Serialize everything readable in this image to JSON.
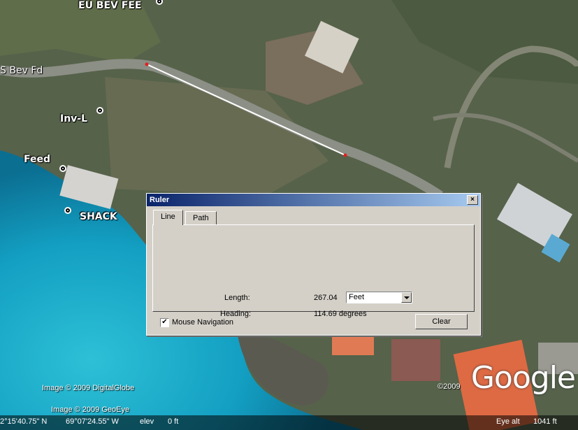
{
  "map": {
    "places": [
      {
        "id": "eu-bev-fee",
        "label": "EU BEV FEE"
      },
      {
        "id": "inv-l",
        "label": "Inv-L"
      },
      {
        "id": "feed",
        "label": "Feed"
      },
      {
        "id": "shack",
        "label": "SHACK"
      }
    ],
    "road_label": "S Bev Fd",
    "credits": {
      "digitalglobe": "Image © 2009 DigitalGlobe",
      "geoeye": "Image © 2009 GeoEye",
      "copyright_year": "©2009"
    },
    "logo": "Google"
  },
  "status": {
    "latitude": "2°15'40.75\" N",
    "longitude": "69°07'24.55\" W",
    "elev_label": "elev",
    "elev_value": "0 ft",
    "eye_alt_label": "Eye alt",
    "eye_alt_value": "1041 ft"
  },
  "ruler": {
    "title": "Ruler",
    "close": "×",
    "tabs": [
      {
        "label": "Line",
        "active": true
      },
      {
        "label": "Path",
        "active": false
      }
    ],
    "length_label": "Length:",
    "length_value": "267.04",
    "unit_selected": "Feet",
    "heading_label": "Heading:",
    "heading_value": "114.69 degrees",
    "mouse_navigation_label": "Mouse Navigation",
    "mouse_navigation_checked": true,
    "clear_label": "Clear"
  },
  "colors": {
    "ocean": "#1aa6c0",
    "land": "#56624a",
    "titlebar": "#0a246a",
    "measure_line": "#ffffff",
    "measure_point": "#e02020"
  },
  "icons": [
    "placemark-icon",
    "close-icon",
    "dropdown-arrow-icon",
    "checkbox-icon"
  ]
}
